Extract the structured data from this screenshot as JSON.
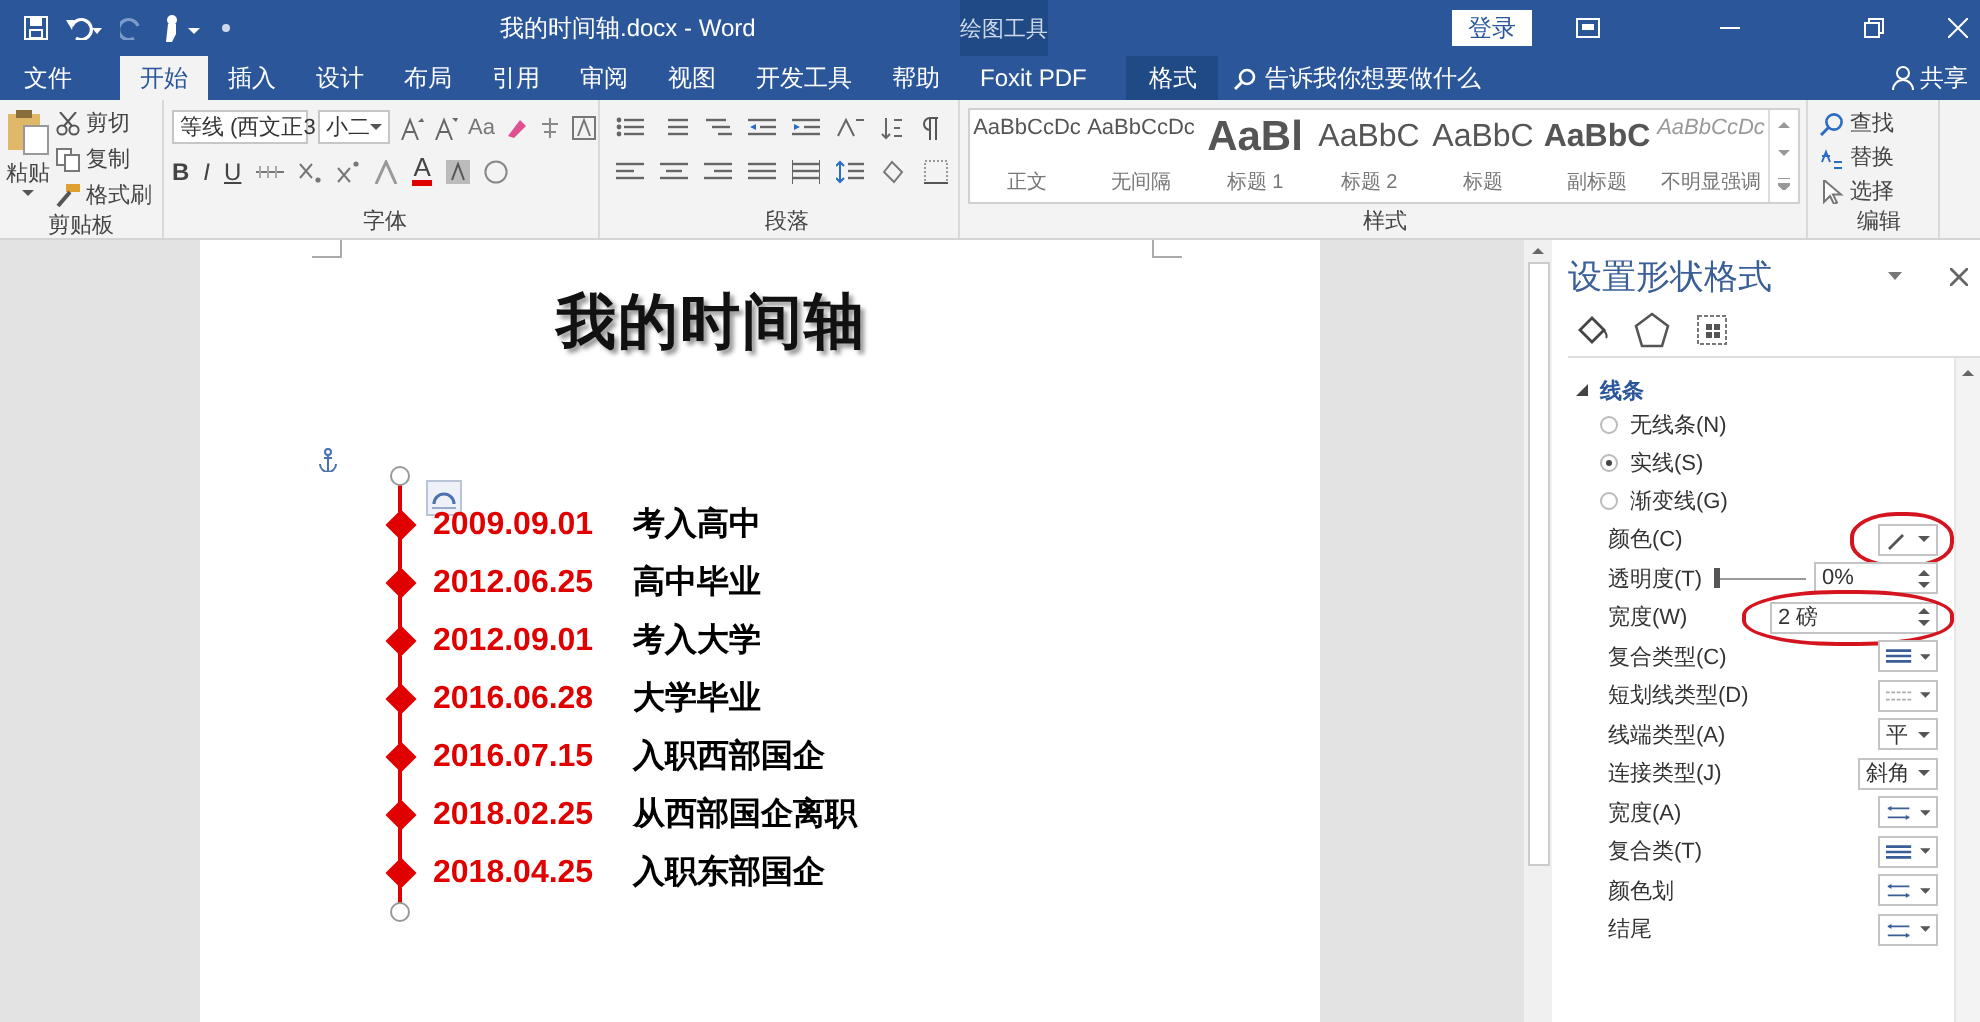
{
  "window": {
    "title": "我的时间轴.docx - Word",
    "context_label": "绘图工具",
    "sign_in": "登录"
  },
  "tabs": [
    {
      "label": "文件",
      "selected": false,
      "kind": "normal"
    },
    {
      "label": "开始",
      "selected": true,
      "kind": "normal"
    },
    {
      "label": "插入",
      "selected": false,
      "kind": "normal"
    },
    {
      "label": "设计",
      "selected": false,
      "kind": "normal"
    },
    {
      "label": "布局",
      "selected": false,
      "kind": "normal"
    },
    {
      "label": "引用",
      "selected": false,
      "kind": "normal"
    },
    {
      "label": "审阅",
      "selected": false,
      "kind": "normal"
    },
    {
      "label": "视图",
      "selected": false,
      "kind": "normal"
    },
    {
      "label": "开发工具",
      "selected": false,
      "kind": "normal"
    },
    {
      "label": "帮助",
      "selected": false,
      "kind": "normal"
    },
    {
      "label": "Foxit PDF",
      "selected": false,
      "kind": "normal"
    },
    {
      "label": "格式",
      "selected": false,
      "kind": "context"
    }
  ],
  "tell_me": {
    "placeholder": "告诉我你想要做什么"
  },
  "share": "共享",
  "ribbon": {
    "clipboard": {
      "label": "剪贴板",
      "paste": "粘贴",
      "items": [
        "剪切",
        "复制",
        "格式刷"
      ]
    },
    "font": {
      "label": "字体",
      "name": "等线 (西文正3",
      "size": "小二",
      "case_button": "Aa",
      "format_buttons": [
        "B",
        "I",
        "U"
      ],
      "color_button": "A"
    },
    "paragraph": {
      "label": "段落"
    },
    "styles": {
      "label": "样式",
      "items": [
        {
          "preview": "AaBbCcDc",
          "name": "正文",
          "kind": "normal"
        },
        {
          "preview": "AaBbCcDc",
          "name": "无间隔",
          "kind": "normal"
        },
        {
          "preview": "AaBl",
          "name": "标题 1",
          "kind": "heading"
        },
        {
          "preview": "AaBbC",
          "name": "标题 2",
          "kind": "heading2"
        },
        {
          "preview": "AaBbC",
          "name": "标题",
          "kind": "heading2"
        },
        {
          "preview": "AaBbC",
          "name": "副标题",
          "kind": "subtitle"
        },
        {
          "preview": "AaBbCcDc",
          "name": "不明显强调",
          "kind": "emphasis"
        }
      ]
    },
    "editing": {
      "label": "编辑",
      "items": [
        "查找",
        "替换",
        "选择"
      ]
    }
  },
  "document": {
    "title": "我的时间轴",
    "events": [
      {
        "date": "2009.09.01",
        "text": "考入高中"
      },
      {
        "date": "2012.06.25",
        "text": "高中毕业"
      },
      {
        "date": "2012.09.01",
        "text": "考入大学"
      },
      {
        "date": "2016.06.28",
        "text": "大学毕业"
      },
      {
        "date": "2016.07.15",
        "text": "入职西部国企"
      },
      {
        "date": "2018.02.25",
        "text": "从西部国企离职"
      },
      {
        "date": "2018.04.25",
        "text": "入职东部国企"
      }
    ]
  },
  "pane": {
    "title": "设置形状格式",
    "section": "线条",
    "expanded": true,
    "line_options": [
      {
        "label": "无线条(N)",
        "selected": false
      },
      {
        "label": "实线(S)",
        "selected": true
      },
      {
        "label": "渐变线(G)",
        "selected": false
      }
    ],
    "properties": [
      {
        "label": "颜色(C)",
        "kind": "color",
        "annotated": true
      },
      {
        "label": "透明度(T)",
        "kind": "slider",
        "level": 0,
        "value": "0%",
        "annotated": false
      },
      {
        "label": "宽度(W)",
        "kind": "spin",
        "value": "2 磅",
        "annotated": true
      },
      {
        "label": "复合类型(C)",
        "kind": "compound",
        "annotated": false
      },
      {
        "label": "短划线类型(D)",
        "kind": "dash",
        "annotated": false
      },
      {
        "label": "线端类型(A)",
        "kind": "dropdown",
        "value": "平",
        "annotated": false
      },
      {
        "label": "连接类型(J)",
        "kind": "dropdown",
        "value": "斜角",
        "annotated": false
      },
      {
        "label": "宽度(A)",
        "kind": "arrow",
        "annotated": false
      },
      {
        "label": "复合类(T)",
        "kind": "compound",
        "annotated": false
      },
      {
        "label": "颜色划",
        "kind": "arrow",
        "annotated": false
      },
      {
        "label": "结尾",
        "kind": "arrow",
        "annotated": false
      }
    ]
  }
}
